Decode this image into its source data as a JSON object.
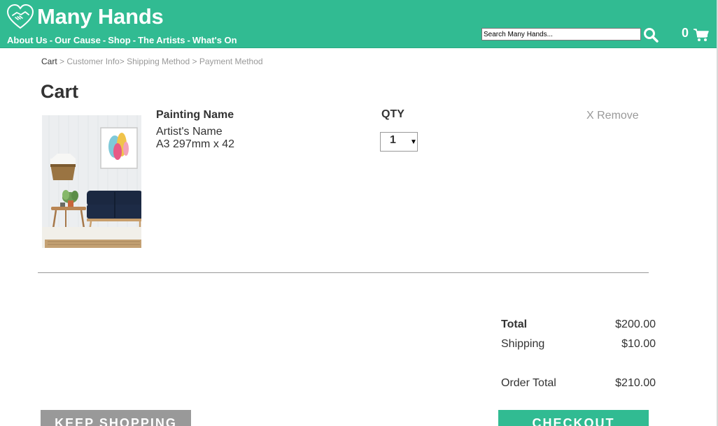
{
  "header": {
    "site_title": "Many Hands",
    "logo_icon": "handshake-heart-icon",
    "nav_items": [
      "About Us",
      "Our Cause",
      "Shop",
      "The Artists",
      "What's On"
    ],
    "nav_separator": "-",
    "search_placeholder": "Search Many Hands...",
    "search_icon": "search-icon",
    "cart_count": "0",
    "cart_icon": "shopping-cart-icon",
    "brand_color": "#31bb92"
  },
  "breadcrumb": {
    "current": "Cart",
    "sep1": " > ",
    "step2": "Customer Info",
    "sep2": "> ",
    "step3": "Shipping Method",
    "sep3": " > ",
    "step4": "Payment Method"
  },
  "page_title": "Cart",
  "cart_item": {
    "name": "Painting Name",
    "artist": "Artist's Name",
    "size": "A3 297mm x 42",
    "qty_label": "QTY",
    "qty_value": "1",
    "remove_label": "X Remove"
  },
  "totals": {
    "total_label": "Total",
    "total_value": "$200.00",
    "shipping_label": "Shipping",
    "shipping_value": "$10.00",
    "order_total_label": "Order Total",
    "order_total_value": "$210.00"
  },
  "buttons": {
    "keep_shopping": "KEEP SHOPPING",
    "checkout": "CHECKOUT",
    "keep_color": "#999999",
    "checkout_color": "#31bb92"
  }
}
